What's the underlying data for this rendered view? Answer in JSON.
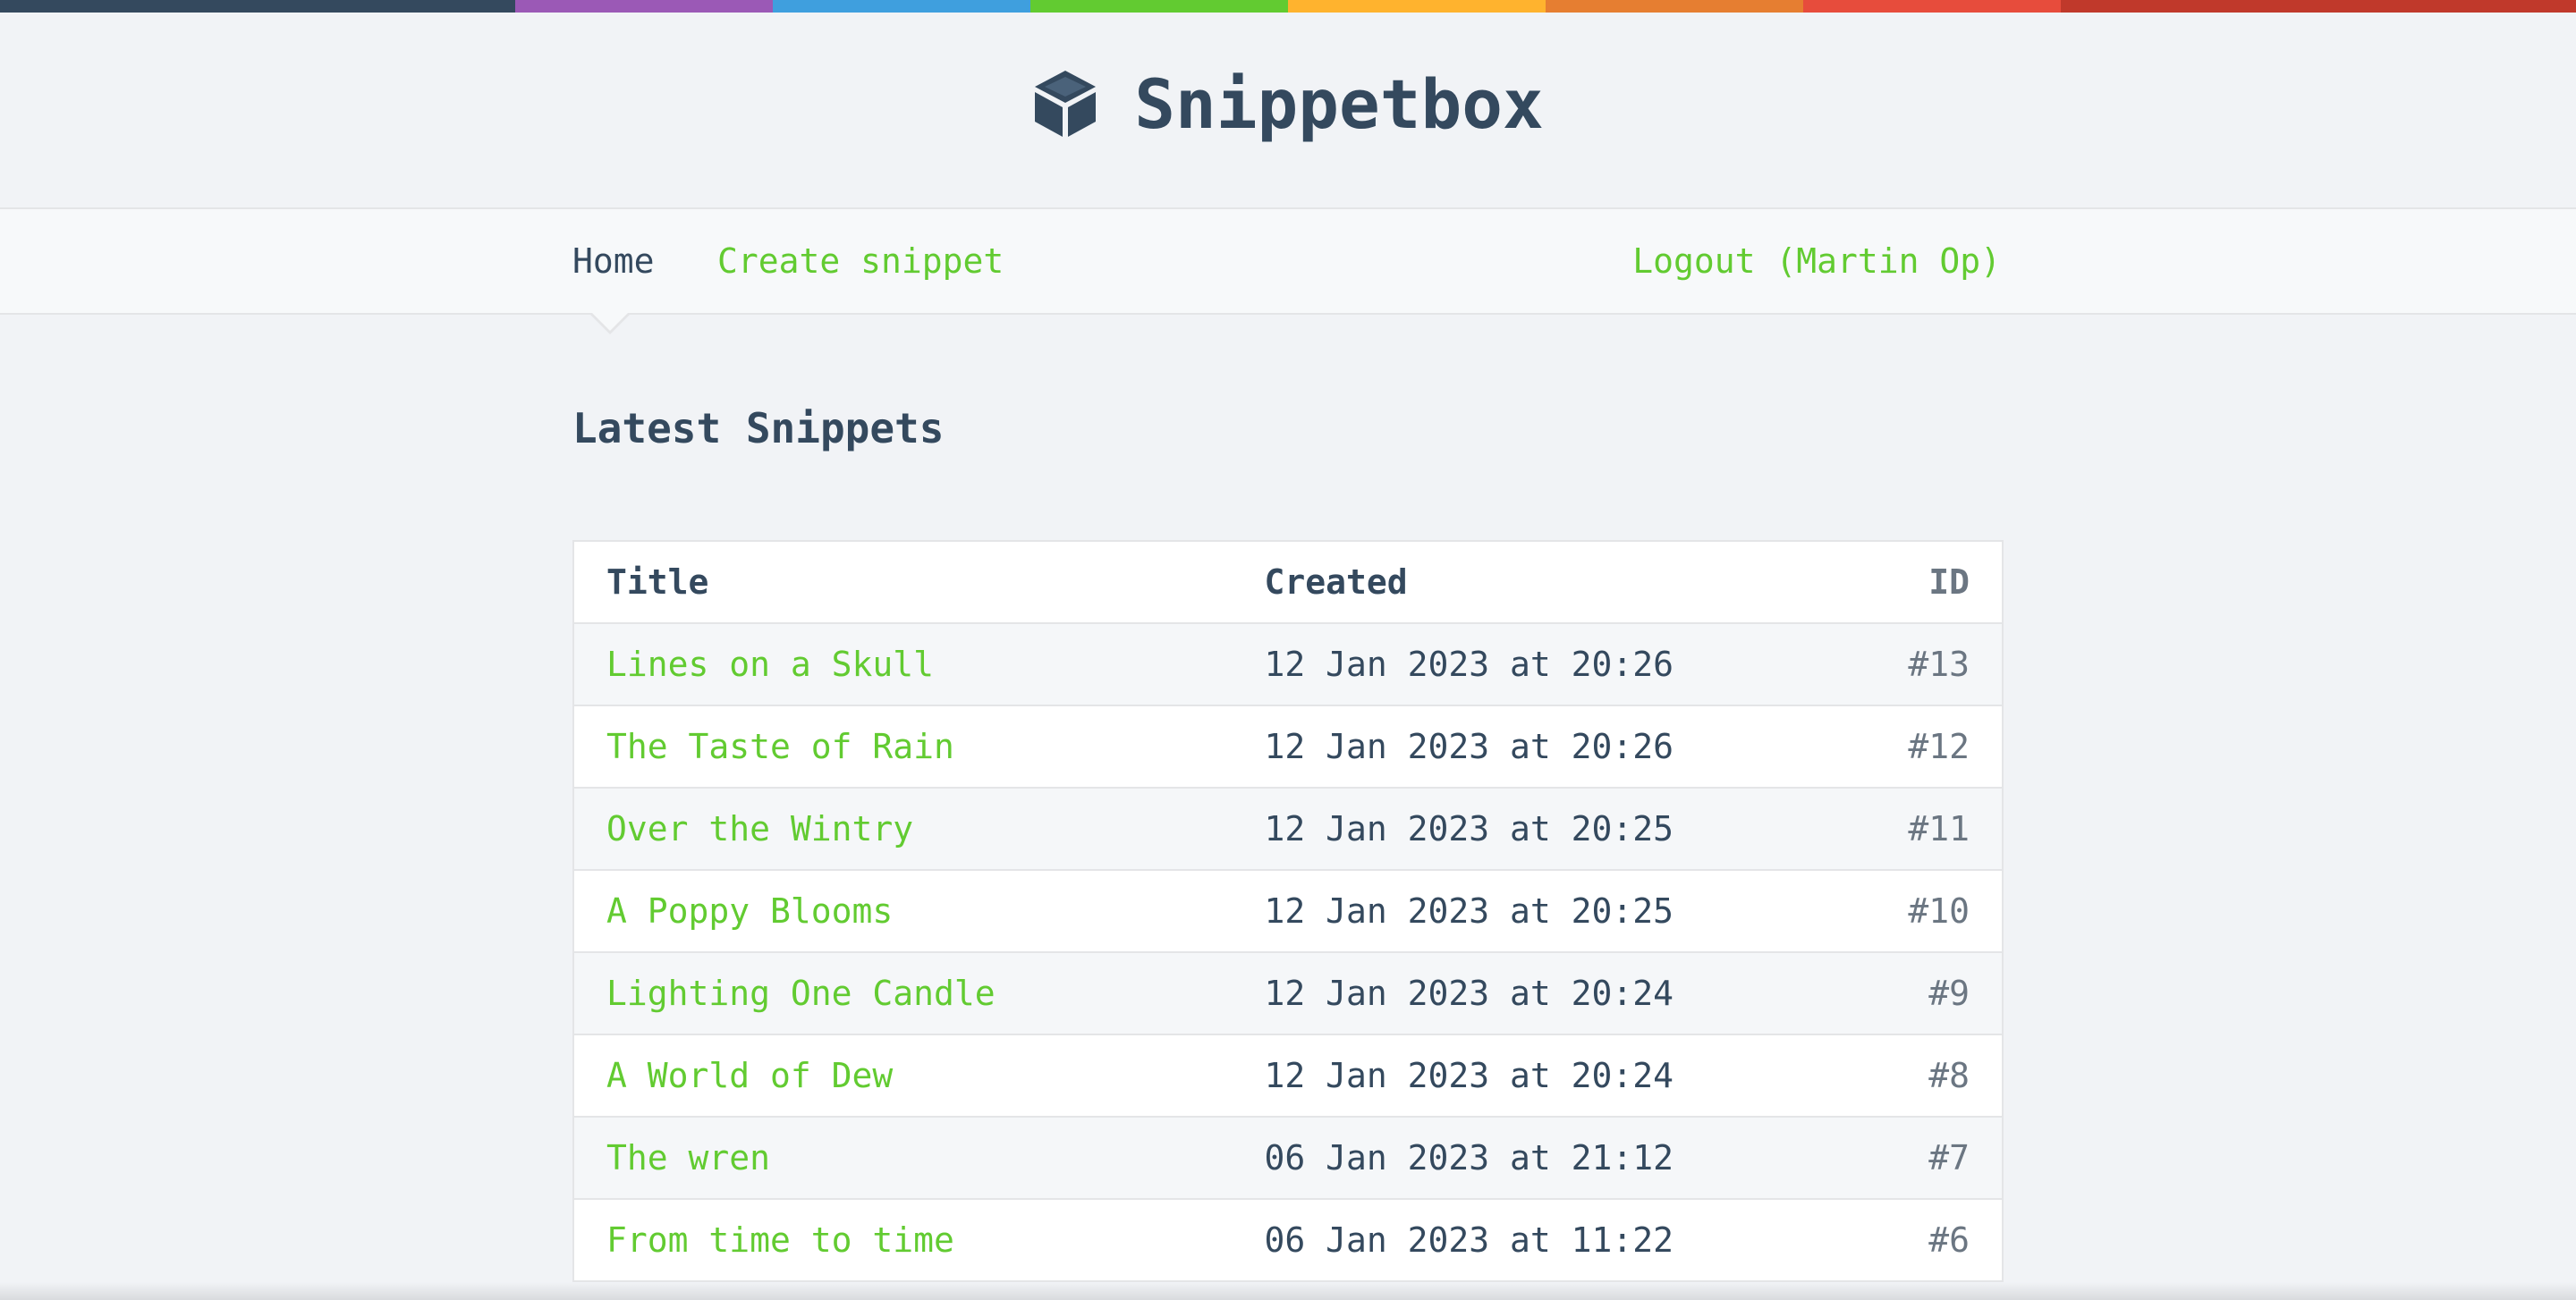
{
  "colors": {
    "accent": "#62cb31",
    "text": "#34495e",
    "background": "#f1f3f6",
    "strip": [
      "#34495e",
      "#34495e",
      "#9b59b6",
      "#3f9fde",
      "#62cb31",
      "#ffb32e",
      "#e67e31",
      "#e74c3c",
      "#c0392b"
    ]
  },
  "header": {
    "logo_icon": "cube-icon",
    "title": "Snippetbox"
  },
  "nav": {
    "home_label": "Home",
    "create_label": "Create snippet",
    "logout_label": "Logout (Martin Op)"
  },
  "main": {
    "heading": "Latest Snippets",
    "table": {
      "columns": [
        "Title",
        "Created",
        "ID"
      ],
      "rows": [
        {
          "title": "Lines on a Skull",
          "created": "12 Jan 2023 at 20:26",
          "id": "#13"
        },
        {
          "title": "The Taste of Rain",
          "created": "12 Jan 2023 at 20:26",
          "id": "#12"
        },
        {
          "title": "Over the Wintry",
          "created": "12 Jan 2023 at 20:25",
          "id": "#11"
        },
        {
          "title": "A Poppy Blooms",
          "created": "12 Jan 2023 at 20:25",
          "id": "#10"
        },
        {
          "title": "Lighting One Candle",
          "created": "12 Jan 2023 at 20:24",
          "id": "#9"
        },
        {
          "title": "A World of Dew",
          "created": "12 Jan 2023 at 20:24",
          "id": "#8"
        },
        {
          "title": "The wren",
          "created": "06 Jan 2023 at 21:12",
          "id": "#7"
        },
        {
          "title": "From time to time",
          "created": "06 Jan 2023 at 11:22",
          "id": "#6"
        }
      ]
    }
  }
}
